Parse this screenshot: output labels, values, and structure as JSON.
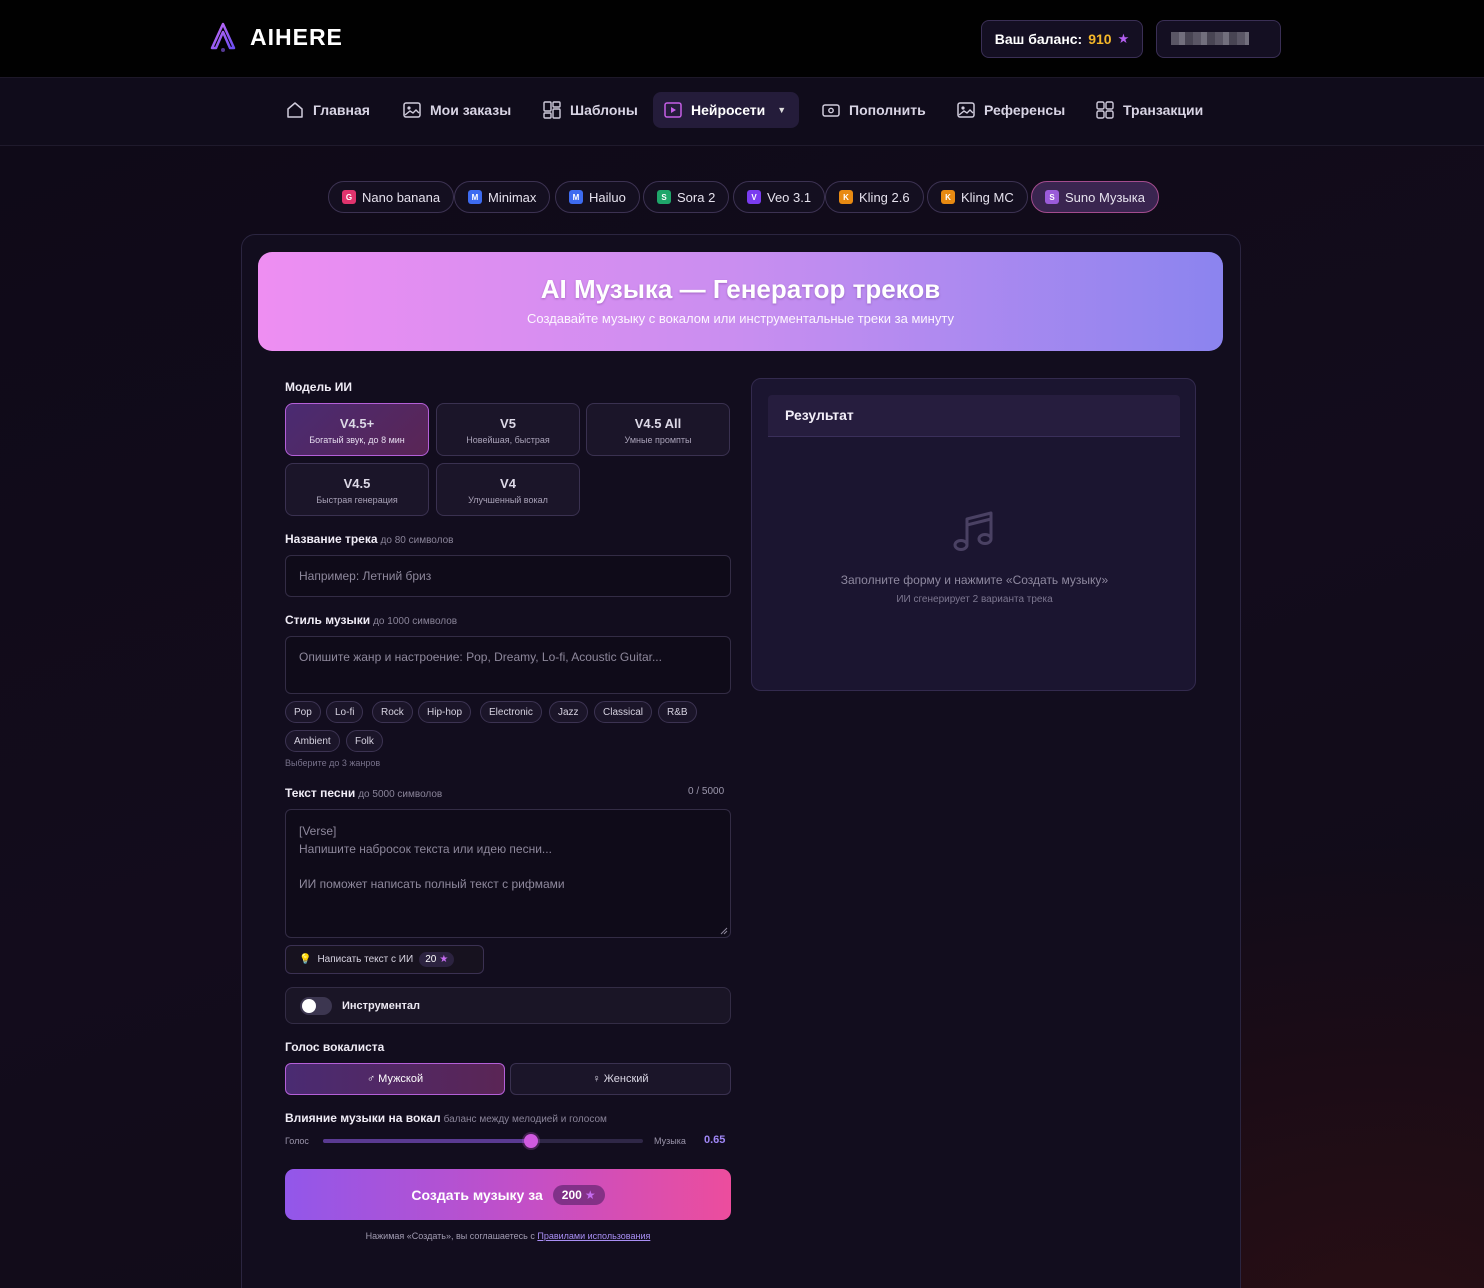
{
  "brand": {
    "name": "AIHERE"
  },
  "header": {
    "balance_label": "Ваш баланс:",
    "balance_value": "910",
    "balance_star": "★",
    "user_name": ""
  },
  "nav": {
    "items": [
      {
        "label": "Главная",
        "icon": "home-icon"
      },
      {
        "label": "Мои заказы",
        "icon": "image-icon"
      },
      {
        "label": "Шаблоны",
        "icon": "layout-icon"
      },
      {
        "label": "Нейросети",
        "icon": "play-icon",
        "active": true
      },
      {
        "label": "Пополнить",
        "icon": "wallet-icon"
      },
      {
        "label": "Референсы",
        "icon": "image-icon"
      },
      {
        "label": "Транзакции",
        "icon": "grid-icon"
      }
    ]
  },
  "models": [
    {
      "label": "Nano banana",
      "letter": "G",
      "color": "#e0336d"
    },
    {
      "label": "Minimax",
      "letter": "M",
      "color": "#3d6bf0"
    },
    {
      "label": "Hailuo",
      "letter": "M",
      "color": "#3d6bf0"
    },
    {
      "label": "Sora 2",
      "letter": "S",
      "color": "#1fa66a"
    },
    {
      "label": "Veo 3.1",
      "letter": "V",
      "color": "#7a3cf0"
    },
    {
      "label": "Kling 2.6",
      "letter": "K",
      "color": "#e88a12"
    },
    {
      "label": "Kling MC",
      "letter": "K",
      "color": "#e88a12"
    },
    {
      "label": "Suno Музыка",
      "letter": "S",
      "color": "#9a5bd9",
      "active": true
    }
  ],
  "hero": {
    "title": "AI Музыка — Генератор треков",
    "subtitle": "Создавайте музыку с вокалом или инструментальные треки за минуту"
  },
  "form": {
    "model_label": "Модель ИИ",
    "ai_models": [
      {
        "title": "V4.5+",
        "desc": "Богатый звук, до 8 мин",
        "active": true
      },
      {
        "title": "V5",
        "desc": "Новейшая, быстрая"
      },
      {
        "title": "V4.5 All",
        "desc": "Умные промпты"
      },
      {
        "title": "V4.5",
        "desc": "Быстрая генерация"
      },
      {
        "title": "V4",
        "desc": "Улучшенный вокал"
      }
    ],
    "track_name_label": "Название трека",
    "track_name_hint": "до 80 символов",
    "track_name_placeholder": "Например: Летний бриз",
    "style_label": "Стиль музыки",
    "style_hint": "до 1000 символов",
    "style_placeholder": "Опишите жанр и настроение: Pop, Dreamy, Lo-fi, Acoustic Guitar...",
    "genres": [
      "Pop",
      "Lo-fi",
      "Rock",
      "Hip-hop",
      "Electronic",
      "Jazz",
      "Classical",
      "R&B",
      "Ambient",
      "Folk"
    ],
    "genres_hint": "Выберите до 3 жанров",
    "lyrics_label": "Текст песни",
    "lyrics_hint": "до 5000 символов",
    "lyrics_counter": "0 / 5000",
    "lyrics_placeholder_1": "[Verse]",
    "lyrics_placeholder_2": "Напишите набросок текста или идею песни...",
    "lyrics_placeholder_3": "ИИ поможет написать полный текст с рифмами",
    "ai_write_label": "Написать текст с ИИ",
    "ai_write_cost": "20",
    "instrumental_label": "Инструментал",
    "instrumental_on": false,
    "voice_label": "Голос вокалиста",
    "voice_male": "♂ Мужской",
    "voice_female": "♀ Женский",
    "influence_label": "Влияние музыки на вокал",
    "influence_hint": "баланс между мелодией и голосом",
    "slider_left": "Голос",
    "slider_right": "Музыка",
    "slider_value": "0.65",
    "slider_fraction": 0.65,
    "create_label": "Создать музыку за",
    "create_cost": "200",
    "terms_text": "Нажимая «Создать», вы соглашаетесь с ",
    "terms_link": "Правилами использования"
  },
  "result": {
    "title": "Результат",
    "empty_line_1": "Заполните форму и нажмите «Создать музыку»",
    "empty_line_2": "ИИ сгенерирует 2 варианта трека"
  }
}
